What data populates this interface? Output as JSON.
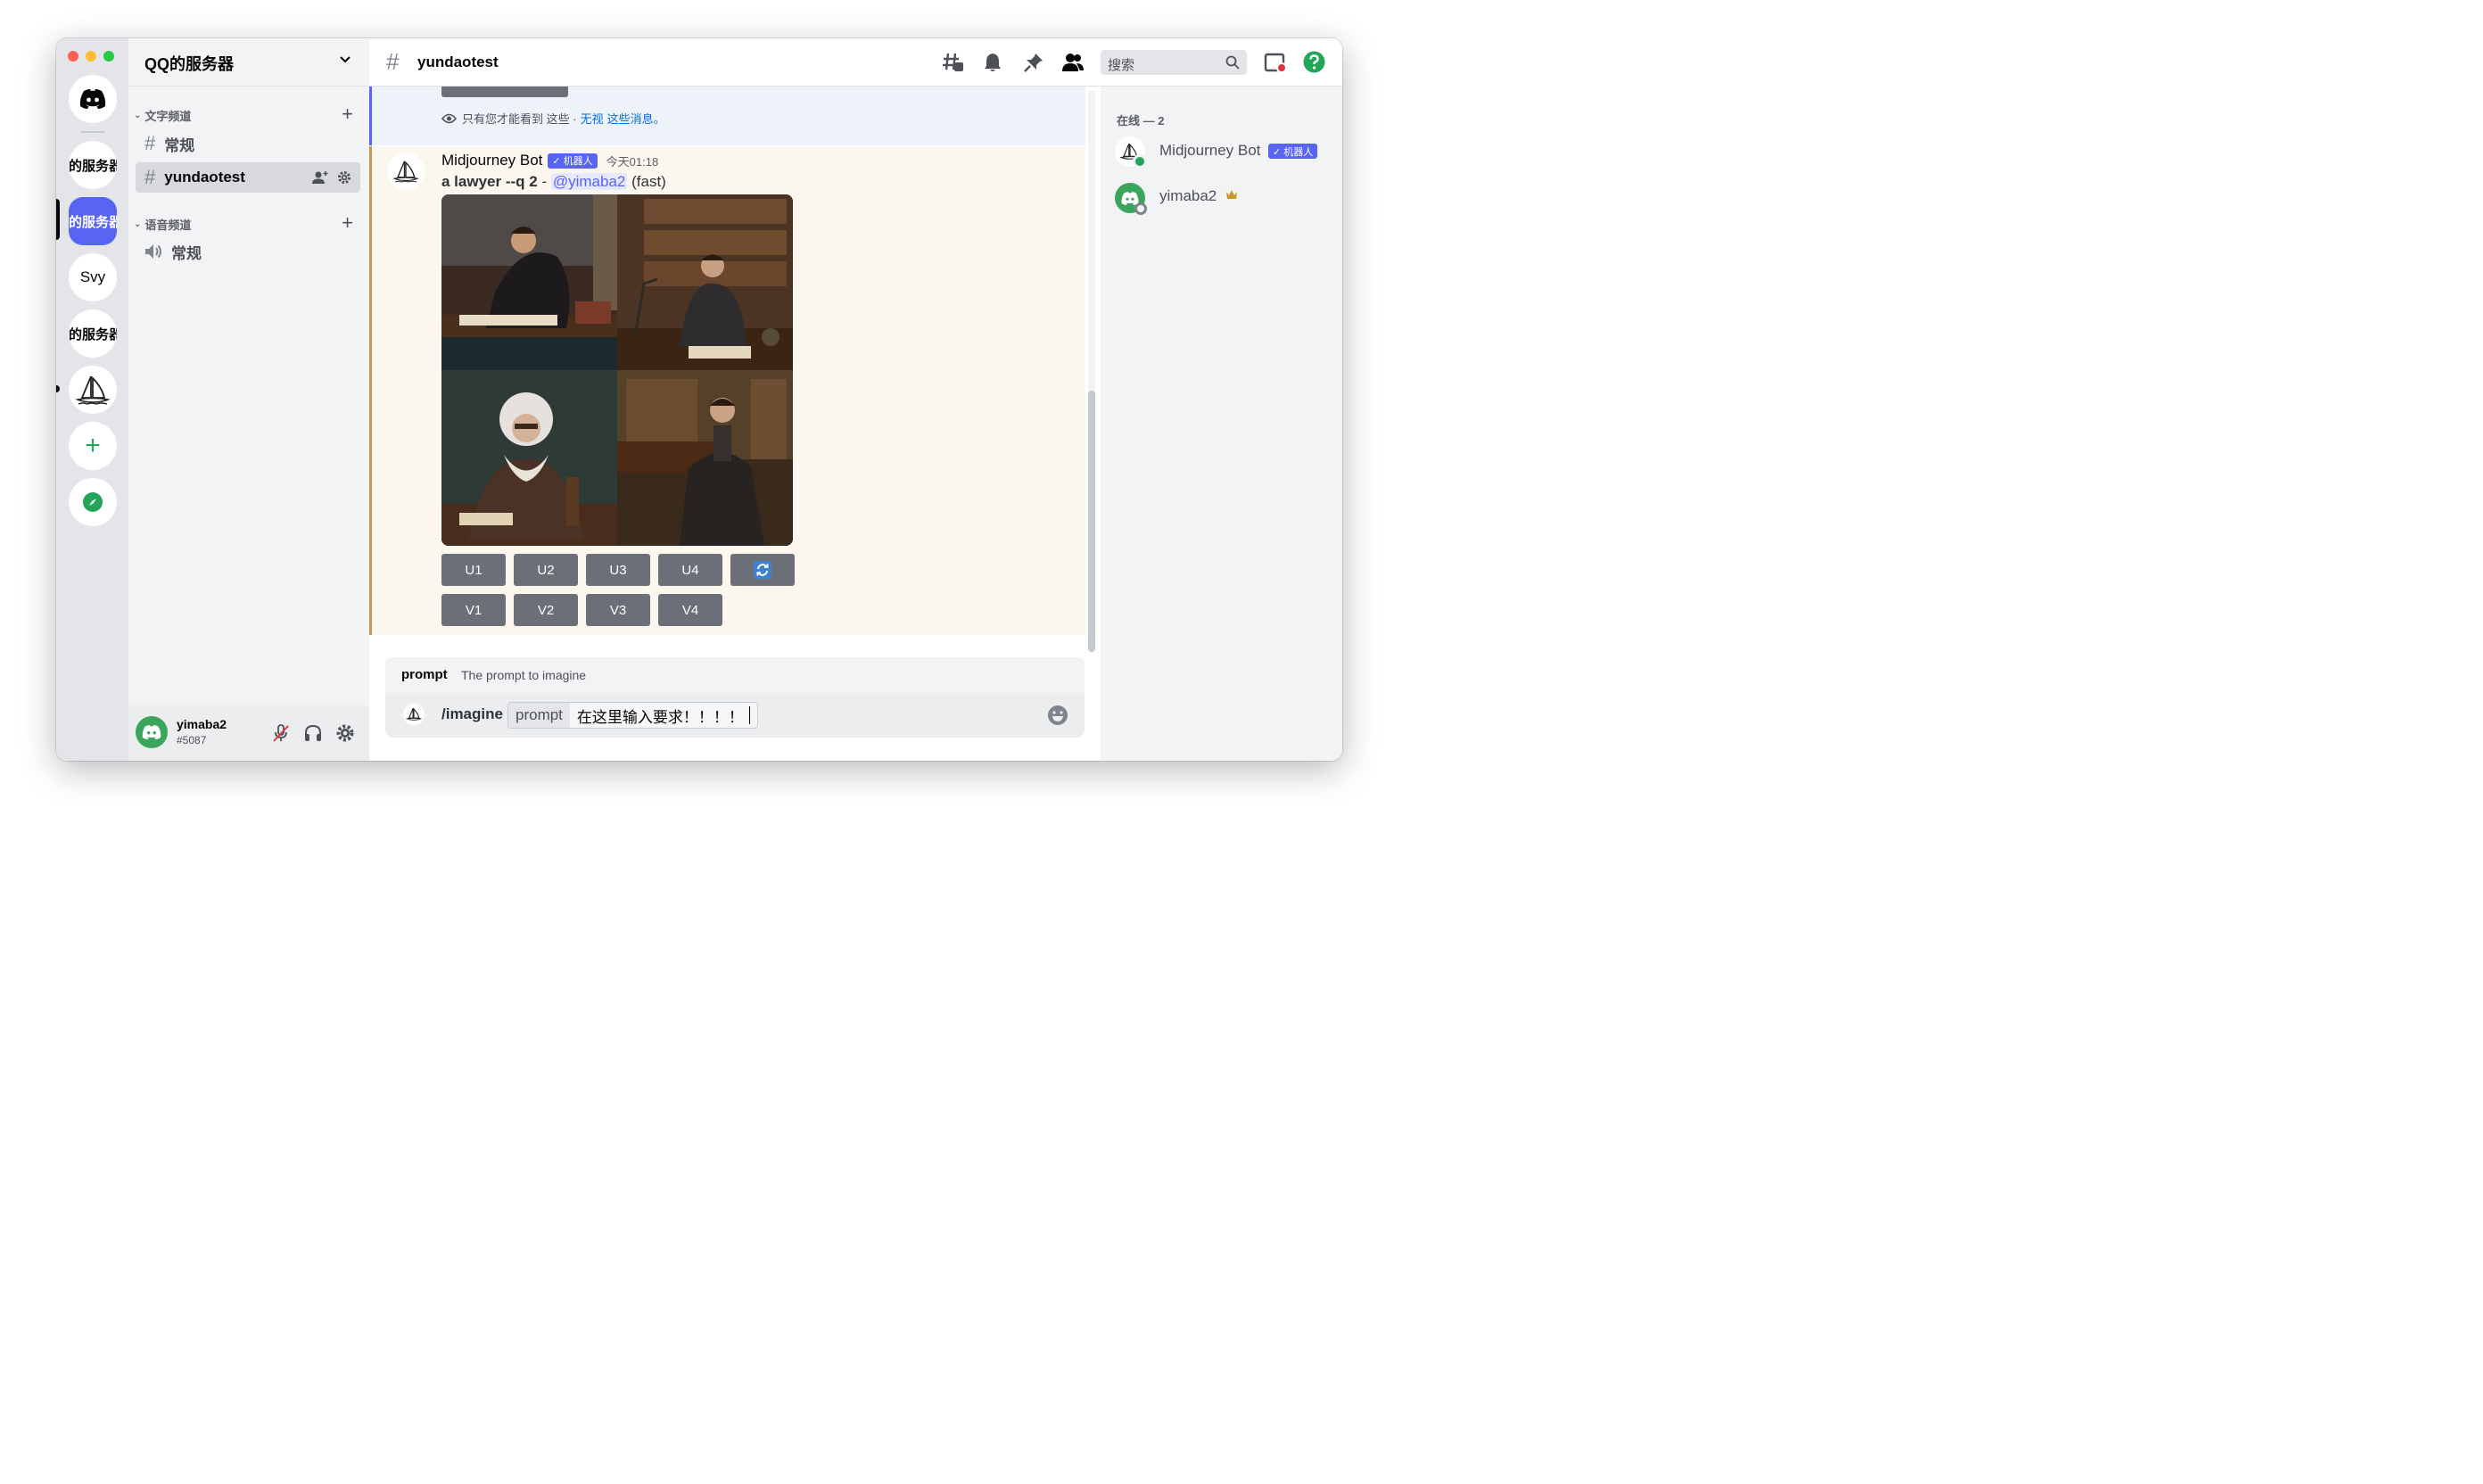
{
  "server": {
    "name": "QQ的服务器"
  },
  "rail": {
    "servers": [
      "的服务器",
      "的服务器",
      "Svy",
      "的服务器"
    ]
  },
  "sidebar": {
    "categories": [
      {
        "label": "文字频道",
        "channels": [
          "常规",
          "yundaotest"
        ]
      },
      {
        "label": "语音频道",
        "channels": [
          "常规"
        ]
      }
    ]
  },
  "user": {
    "name": "yimaba2",
    "tag": "#5087"
  },
  "header": {
    "channel": "yundaotest",
    "search_placeholder": "搜索"
  },
  "ephemeral": {
    "prefix": "只有您才能看到 这些 ·",
    "dismiss": "无视",
    "suffix": "这些消息。"
  },
  "message": {
    "author": "Midjourney Bot",
    "bot_badge": "✓ 机器人",
    "time": "今天01:18",
    "prompt": "a lawyer --q 2",
    "dash": "-",
    "mention": "@yimaba2",
    "mode": "(fast)",
    "buttons_row1": [
      "U1",
      "U2",
      "U3",
      "U4"
    ],
    "buttons_row2": [
      "V1",
      "V2",
      "V3",
      "V4"
    ]
  },
  "composer": {
    "option_name": "prompt",
    "option_desc": "The prompt to imagine",
    "command": "/imagine",
    "param": "prompt",
    "value": "在这里输入要求！！！！"
  },
  "member_list": {
    "heading": "在线 — 2",
    "members": [
      {
        "name": "Midjourney Bot",
        "badge": "✓ 机器人"
      },
      {
        "name": "yimaba2"
      }
    ]
  },
  "colors": {
    "blurple": "#5865f2",
    "online": "#23a55a",
    "highlight_bg": "#fbf7ee",
    "highlight_bar": "#c69a4a",
    "button_gray": "#6d6f78",
    "help_green": "#23a55a"
  }
}
